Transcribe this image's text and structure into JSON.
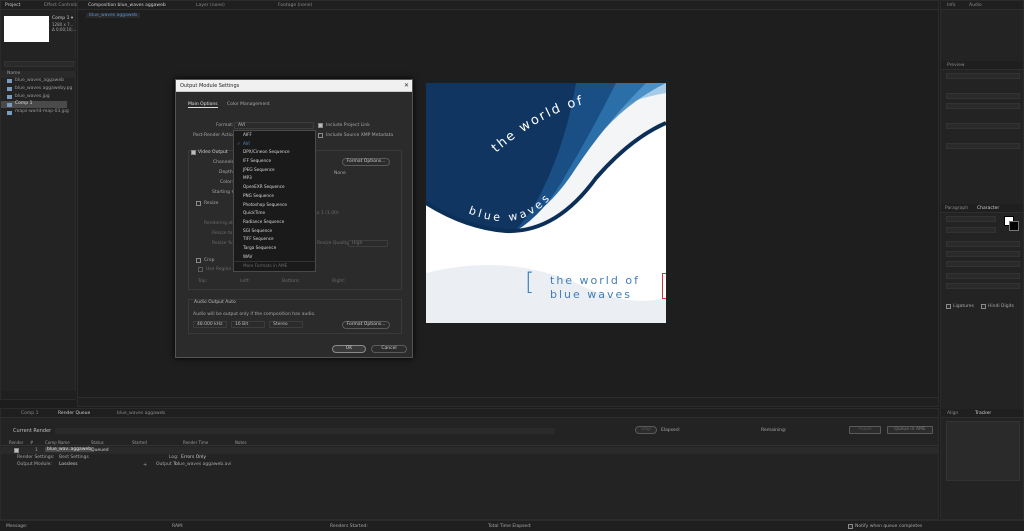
{
  "project_panel": {
    "tabs": [
      "Project",
      "Effect Controls"
    ],
    "comp_name": "Comp 1 ▾",
    "comp_info": [
      "1280 x 7...",
      "Δ 0;00;10;..."
    ],
    "column_name": "Name",
    "items": [
      "blue_waves_aggaweb",
      "blue_waves aggaweby.pg",
      "blue_waves.jpg",
      "Comp 1",
      "maps-world-map-03.jpg"
    ]
  },
  "composition_panel": {
    "tabs": [
      "Composition blue_waves aggaweb",
      "Layer (none)",
      "Footage (none)"
    ],
    "breadcrumb": "blue_waves aggaweb"
  },
  "artwork": {
    "arc_text": "the world of",
    "wave_text": "blue waves",
    "title_line1": "the world of",
    "title_line2": "blue waves",
    "bracket": "["
  },
  "dialog": {
    "title": "Output Module Settings",
    "tabs": [
      "Main Options",
      "Color Management"
    ],
    "format_label": "Format:",
    "format_value": "AVI",
    "post_render_label": "Post-Render Action:",
    "include_project_link": "Include Project Link",
    "include_xmp": "Include Source XMP Metadata",
    "video_output": "Video Output",
    "channels": "Channels:",
    "depth": "Depth:",
    "color": "Color:",
    "starting": "Starting #:",
    "format_options": "Format Options...",
    "none_text": "None",
    "resize": "Resize",
    "rendering_at": "Rendering at:",
    "resize_to": "Resize to:",
    "resize_pct": "Resize %:",
    "lock_ratio": "to 1 (1.00)",
    "resize_quality": "Resize Quality:",
    "resize_quality_value": "High",
    "crop": "Crop",
    "use_region": "Use Region of Interest",
    "top": "Top:",
    "left": "Left:",
    "bottom": "Bottom:",
    "right": "Right:",
    "audio_output": "Audio Output Auto",
    "audio_note": "Audio will be output only if the composition has audio.",
    "sample_rate": "48.000 kHz",
    "bit_depth": "16 Bit",
    "channels_audio": "Stereo",
    "audio_format_options": "Format Options...",
    "ok": "OK",
    "cancel": "Cancel",
    "format_menu": [
      "AIFF",
      "AVI",
      "DPX/Cineon Sequence",
      "IFF Sequence",
      "JPEG Sequence",
      "MP3",
      "OpenEXR Sequence",
      "PNG Sequence",
      "Photoshop Sequence",
      "QuickTime",
      "Radiance Sequence",
      "SGI Sequence",
      "TIFF Sequence",
      "Targa Sequence",
      "WAV",
      "More Formats in AME"
    ]
  },
  "render_queue": {
    "tabs": [
      "Comp 1",
      "Render Queue",
      "blue_waves aggaweb"
    ],
    "current_render": "Current Render",
    "elapsed_label": "Elapsed:",
    "remaining_label": "Remaining:",
    "stop": "Stop",
    "pause": "Pause",
    "queue_in_ame": "Queue in AME",
    "headers": [
      "Render",
      "#",
      "Comp Name",
      "Status",
      "Started",
      "Render Time",
      "Notes"
    ],
    "item": {
      "num": "1",
      "comp": "blue_wav..aggaweb",
      "status": "Queued"
    },
    "render_settings_label": "Render Settings:",
    "render_settings_value": "Best Settings",
    "log_label": "Log:",
    "log_value": "Errors Only",
    "output_module_label": "Output Module:",
    "output_module_value": "Lossless",
    "output_to_label": "Output To:",
    "output_to_value": "blue_waves aggaweb.avi"
  },
  "status_bar": {
    "message": "Message:",
    "ram": "RAM:",
    "renders_started": "Renders Started:",
    "total_elapsed": "Total Time Elapsed:",
    "notify": "Notify when queue completes"
  },
  "right_panels": {
    "info_tabs": [
      "Info",
      "Audio"
    ],
    "preview_tab": "Preview",
    "paragraph_tab": "Paragraph",
    "character_tab": "Character",
    "align_tab": "Align",
    "tracker_tab": "Tracker",
    "ligatures": "Ligatures",
    "hindi_digits": "Hindi Digits"
  },
  "colors": {
    "accent": "#4f8fd6",
    "bg": "#1d1d1d",
    "panel": "#232323",
    "wave_dark": "#1a4f86",
    "wave_mid": "#3b86c0"
  }
}
